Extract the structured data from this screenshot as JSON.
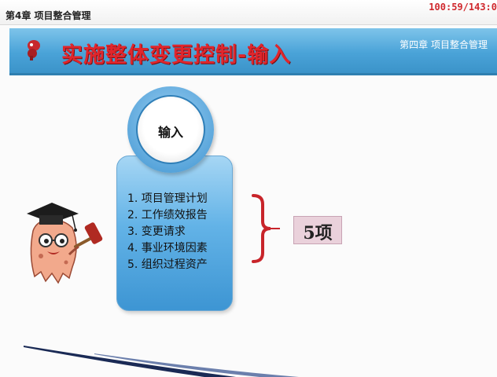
{
  "window": {
    "chapter_title": "第4章 项目整合管理",
    "counter": "100:59/143:0"
  },
  "header": {
    "slide_title": "实施整体变更控制-输入",
    "chapter_label": "第四章 项目整合管理"
  },
  "main": {
    "circle_label": "输入",
    "inputs": [
      "1. 项目管理计划",
      "2. 工作绩效报告",
      "3. 变更请求",
      "4. 事业环境因素",
      "5. 组织过程资产"
    ],
    "count_label": "5项"
  },
  "colors": {
    "title_red": "#e0262c",
    "header_blue": "#4aa3d8",
    "panel_blue": "#63b3e7",
    "brace_red": "#c8242a",
    "count_box_pink": "#ead1db",
    "counter_red": "#d0282d"
  },
  "icons": {
    "header_logo": "red-figure-icon",
    "mascot": "graduate-mascot-with-gavel",
    "brace": "right-curly-brace-icon"
  }
}
